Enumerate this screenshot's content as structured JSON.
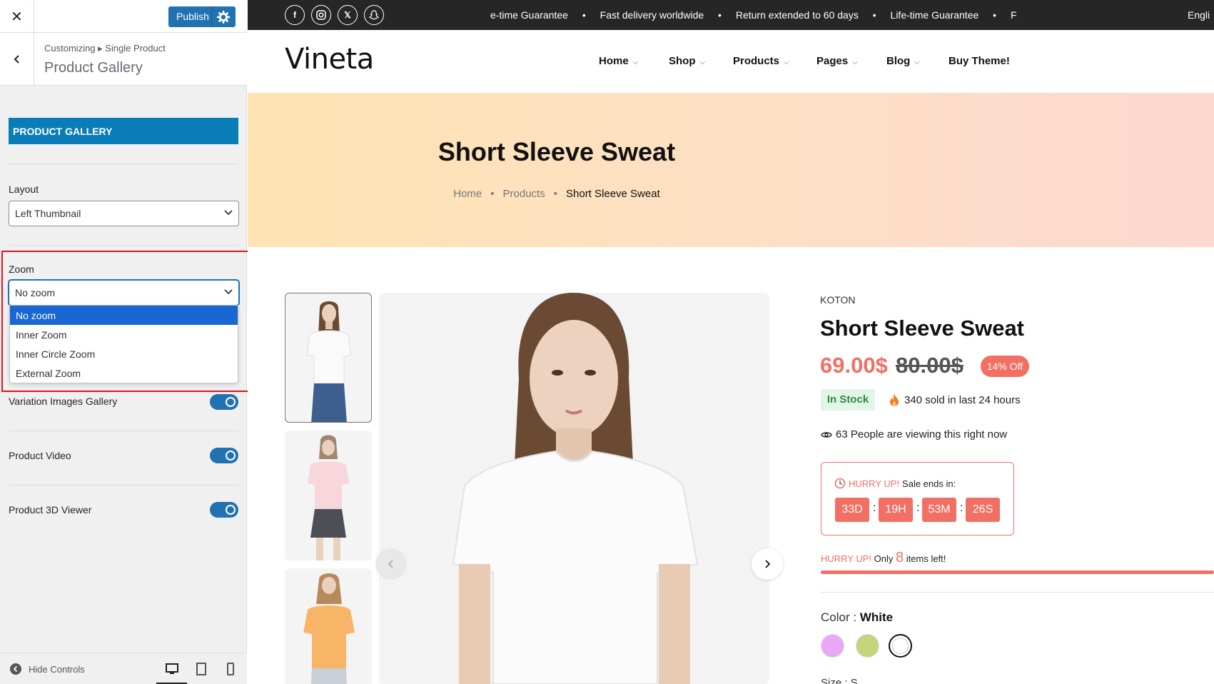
{
  "customizer": {
    "publish_label": "Publish",
    "breadcrumb": "Customizing ▸ Single Product",
    "title": "Product Gallery",
    "section_header": "PRODUCT GALLERY",
    "layout": {
      "label": "Layout",
      "value": "Left Thumbnail"
    },
    "zoom": {
      "label": "Zoom",
      "value": "No zoom",
      "options": [
        "No zoom",
        "Inner Zoom",
        "Inner Circle Zoom",
        "External Zoom"
      ]
    },
    "toggles": [
      {
        "label": "Variation Images Gallery",
        "on": true
      },
      {
        "label": "Product Video",
        "on": true
      },
      {
        "label": "Product 3D Viewer",
        "on": true
      }
    ],
    "hide_controls": "Hide Controls"
  },
  "preview": {
    "ticker": [
      "e-time Guarantee",
      "•",
      "Fast delivery worldwide",
      "•",
      "Return extended to 60 days",
      "•",
      "Life-time Guarantee",
      "•",
      "Fast delive"
    ],
    "language": "Engli",
    "logo": "Vineta",
    "nav": [
      "Home",
      "Shop",
      "Products",
      "Pages",
      "Blog",
      "Buy Theme!"
    ],
    "hero": {
      "title": "Short Sleeve Sweat",
      "breadcrumb": [
        "Home",
        "Products",
        "Short Sleeve Sweat"
      ]
    },
    "product": {
      "brand": "KOTON",
      "title": "Short Sleeve Sweat",
      "price": "69.00$",
      "old_price": "80.00$",
      "discount": "14% Off",
      "stock": "In Stock",
      "sold": "340 sold in last 24 hours",
      "viewing": "63 People are viewing this right now",
      "hurry_label": "HURRY UP!",
      "sale_ends": "Sale ends in:",
      "countdown": [
        "33D",
        "19H",
        "53M",
        "26S"
      ],
      "items_left_prefix": "HURRY UP!",
      "items_left_only": "Only",
      "items_left_count": "8",
      "items_left_suffix": "items left!",
      "color_label": "Color :",
      "color_value": "White",
      "swatches": [
        "#e9a8f5",
        "#c3d67d",
        "#ffffff"
      ],
      "size_label": "Size : S"
    }
  },
  "colors": {
    "accent": "#2271b1",
    "section": "#0a7db8",
    "sale": "#f26f63",
    "highlight": "#e0131d"
  }
}
